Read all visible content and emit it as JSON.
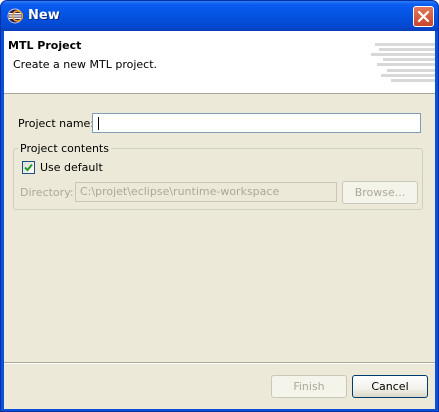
{
  "window": {
    "title": "New",
    "accent_color": "#0a50d8",
    "icon": "eclipse-icon",
    "close_icon": "close-icon"
  },
  "header": {
    "title": "MTL Project",
    "description": "Create a new MTL project.",
    "graphic_icon": "wizard-banner-icon"
  },
  "form": {
    "project_name_label": "Project name:",
    "project_name_value": "",
    "project_contents_label": "Project contents",
    "use_default_label": "Use default",
    "use_default_checked": true,
    "directory_label": "Directory:",
    "directory_value": "C:\\projet\\eclipse\\runtime-workspace",
    "browse_label": "Browse..."
  },
  "buttons": {
    "finish_label": "Finish",
    "cancel_label": "Cancel"
  }
}
